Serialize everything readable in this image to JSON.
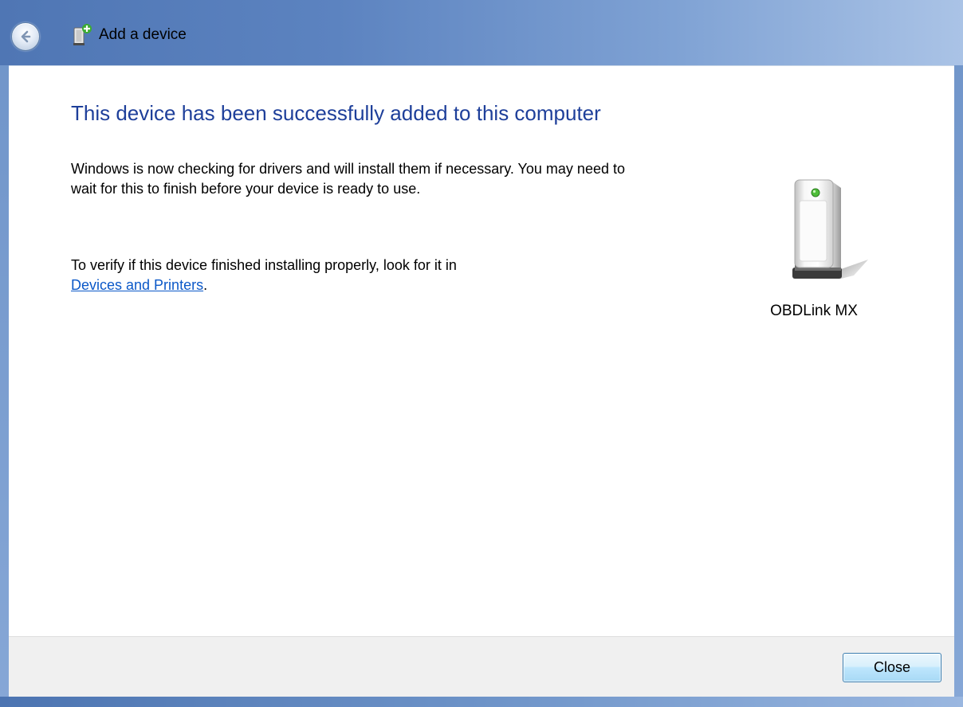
{
  "window": {
    "title": "Add a device",
    "frame_color": "#5c83c0"
  },
  "main": {
    "heading": "This device has been successfully added to this computer",
    "paragraph1": "Windows is now checking for drivers and will install them if necessary. You may need to wait for this to finish before your device is ready to use.",
    "paragraph2_prefix": "To verify if this device finished installing properly, look for it in",
    "link_text": "Devices and Printers",
    "paragraph2_suffix": "."
  },
  "device": {
    "name": "OBDLink MX",
    "icon": "device-tower-icon",
    "status_light_color": "#4fbf3a"
  },
  "footer": {
    "close_label": "Close"
  },
  "colors": {
    "heading": "#1e3f9a",
    "link": "#0b58c8"
  }
}
